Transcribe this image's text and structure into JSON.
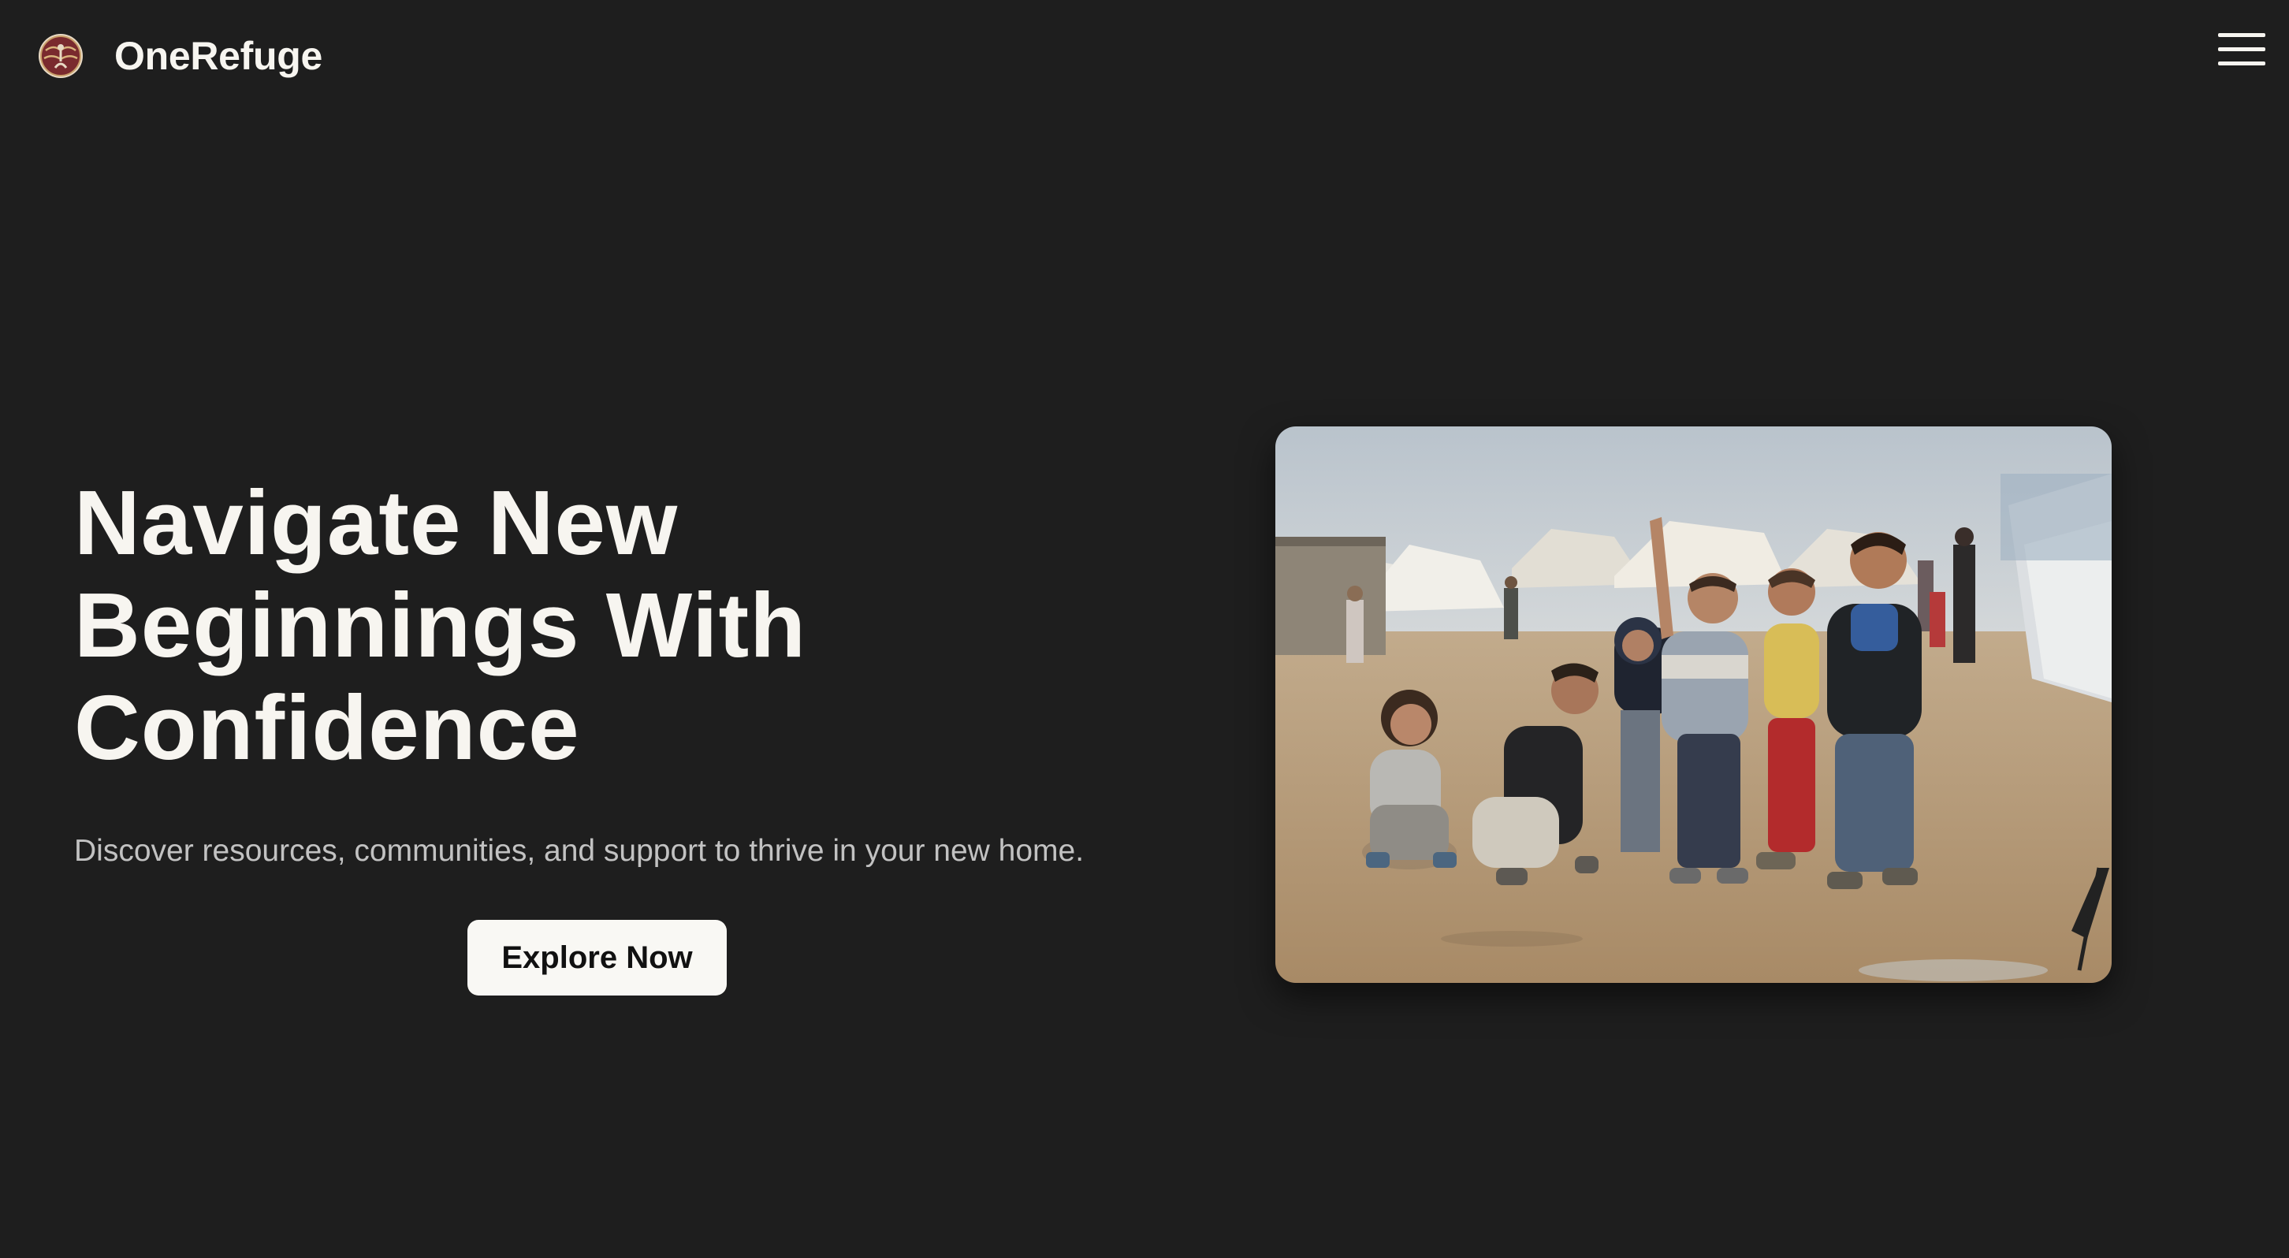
{
  "header": {
    "brand_name": "OneRefuge",
    "logo_icon": "globe-hands-logo-icon",
    "menu_icon": "hamburger-menu-icon"
  },
  "hero": {
    "title": "Navigate New Beginnings With Confidence",
    "subtitle": "Discover resources, communities, and support to thrive in your new home.",
    "cta_label": "Explore Now",
    "image_subject": "children-in-refugee-camp-photo"
  },
  "colors": {
    "background": "#1e1e1e",
    "text_primary": "#f7f5f0",
    "text_secondary": "#c2c2c2",
    "button_bg": "#f9f8f4",
    "button_text": "#111111"
  }
}
